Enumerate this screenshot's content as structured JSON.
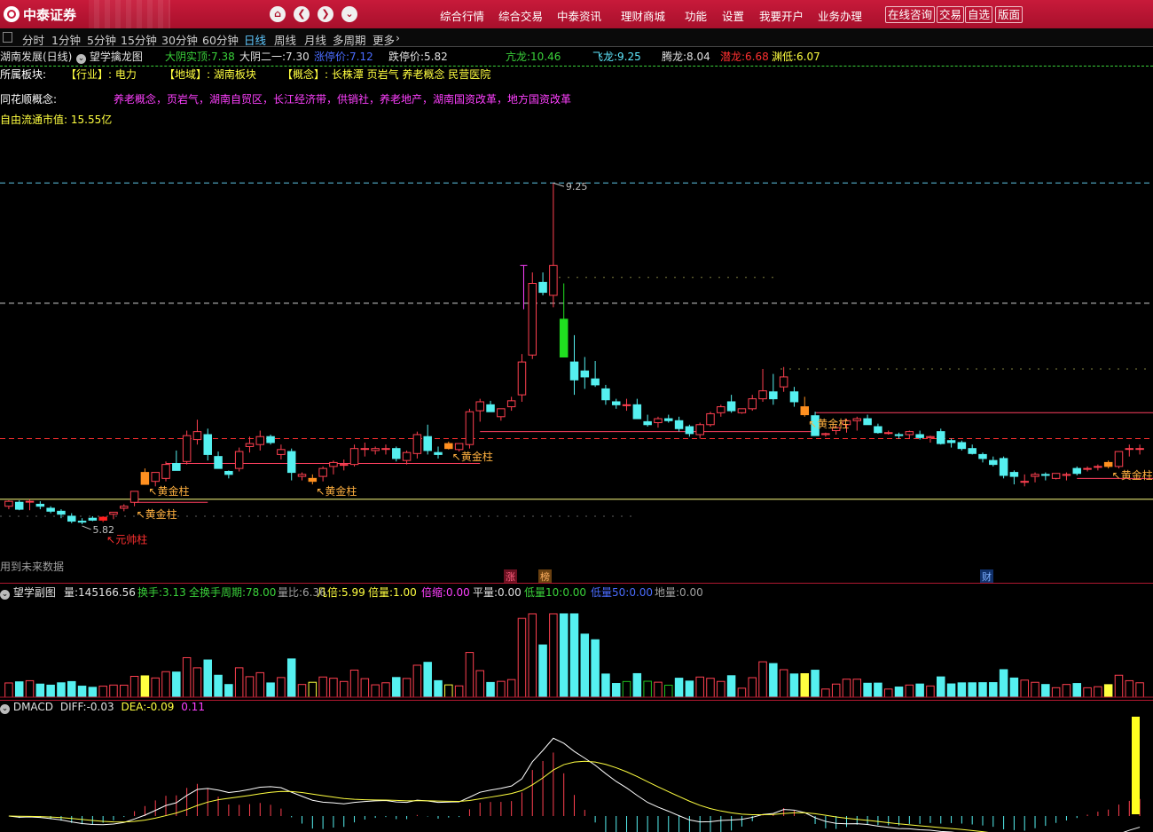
{
  "topbar": {
    "logo": "中泰证券",
    "menu": [
      "综合行情",
      "综合交易",
      "中泰资讯",
      "理财商城",
      "功能",
      "设置",
      "我要开户",
      "业务办理"
    ],
    "buttons": [
      "在线咨询",
      "交易",
      "自选",
      "版面"
    ]
  },
  "periods": {
    "items": [
      "分时",
      "1分钟",
      "5分钟",
      "15分钟",
      "30分钟",
      "60分钟",
      "日线",
      "周线",
      "月线",
      "多周期",
      "更多"
    ],
    "active": "日线"
  },
  "header": {
    "title": "湖南发展(日线)",
    "indicator_name": "望学擒龙图",
    "stats": [
      {
        "label": "大阴实顶:",
        "value": "7.38",
        "color": "#3ad23a"
      },
      {
        "label": "大阴二一:",
        "value": "7.30",
        "color": "#e0e0e0"
      },
      {
        "label": "涨停价:",
        "value": "7.12",
        "color": "#4a6cff"
      },
      {
        "label": "跌停价:",
        "value": "5.82",
        "color": "#e0e0e0"
      },
      {
        "label": "亢龙:",
        "value": "10.46",
        "color": "#3ad23a"
      },
      {
        "label": "飞龙:",
        "value": "9.25",
        "color": "#5fe8ff"
      },
      {
        "label": "腾龙:",
        "value": "8.04",
        "color": "#e0e0e0"
      },
      {
        "label": "潜龙:",
        "value": "6.68",
        "color": "#ff3030"
      },
      {
        "label": "渊低:",
        "value": "6.07",
        "color": "#ffff40"
      }
    ]
  },
  "info": {
    "sector_label": "所属板块:",
    "industry": "【行业】: 电力",
    "region": "【地域】: 湖南板块",
    "concept": "【概念】: 长株潭 页岩气 养老概念 民营医院",
    "ths_label": "同花顺概念:",
    "ths_concepts": "养老概念，页岩气，湖南自贸区，长江经济带，供销社，养老地产，湖南国资改革，地方国资改革",
    "float_cap": "自由流通市值: 15.55亿"
  },
  "main_chart": {
    "annotations": {
      "high_label": "9.25",
      "low_label": "5.82",
      "gold": "黄金柱",
      "yuanshuai": "元帅柱",
      "future": "用到未来数据",
      "zhang": "涨",
      "bang": "榜",
      "cai": "财"
    },
    "candles": [
      [
        6.0,
        6.06,
        5.97,
        6.05
      ],
      [
        6.04,
        6.06,
        5.96,
        5.97
      ],
      [
        6.05,
        6.07,
        5.96,
        6.05
      ],
      [
        6.02,
        6.05,
        5.97,
        6.0
      ],
      [
        5.98,
        6.0,
        5.93,
        5.95
      ],
      [
        5.95,
        5.97,
        5.88,
        5.92
      ],
      [
        5.9,
        5.93,
        5.83,
        5.85
      ],
      [
        5.85,
        5.88,
        5.82,
        5.84
      ],
      [
        5.88,
        5.9,
        5.85,
        5.86
      ],
      [
        5.86,
        5.9,
        5.84,
        5.89
      ],
      [
        5.92,
        5.94,
        5.87,
        5.94
      ],
      [
        5.98,
        6.02,
        5.95,
        6.0
      ],
      [
        6.04,
        6.15,
        6.0,
        6.15
      ],
      [
        6.34,
        6.38,
        6.22,
        6.22
      ],
      [
        6.25,
        6.34,
        6.2,
        6.34
      ],
      [
        6.28,
        6.45,
        6.25,
        6.42
      ],
      [
        6.43,
        6.56,
        6.36,
        6.36
      ],
      [
        6.45,
        6.76,
        6.42,
        6.71
      ],
      [
        6.67,
        6.87,
        6.62,
        6.75
      ],
      [
        6.72,
        6.78,
        6.46,
        6.52
      ],
      [
        6.5,
        6.55,
        6.38,
        6.38
      ],
      [
        6.35,
        6.36,
        6.28,
        6.32
      ],
      [
        6.38,
        6.59,
        6.35,
        6.55
      ],
      [
        6.6,
        6.7,
        6.54,
        6.63
      ],
      [
        6.62,
        6.76,
        6.56,
        6.7
      ],
      [
        6.7,
        6.72,
        6.62,
        6.64
      ],
      [
        6.52,
        6.62,
        6.47,
        6.57
      ],
      [
        6.55,
        6.58,
        6.26,
        6.34
      ],
      [
        6.3,
        6.34,
        6.26,
        6.32
      ],
      [
        6.25,
        6.32,
        6.22,
        6.28
      ],
      [
        6.3,
        6.4,
        6.25,
        6.38
      ],
      [
        6.4,
        6.46,
        6.32,
        6.44
      ],
      [
        6.42,
        6.47,
        6.36,
        6.42
      ],
      [
        6.42,
        6.62,
        6.4,
        6.58
      ],
      [
        6.58,
        6.64,
        6.5,
        6.58
      ],
      [
        6.56,
        6.6,
        6.52,
        6.58
      ],
      [
        6.58,
        6.62,
        6.52,
        6.58
      ],
      [
        6.58,
        6.6,
        6.45,
        6.48
      ],
      [
        6.46,
        6.56,
        6.42,
        6.54
      ],
      [
        6.53,
        6.75,
        6.48,
        6.72
      ],
      [
        6.7,
        6.82,
        6.52,
        6.56
      ],
      [
        6.54,
        6.6,
        6.48,
        6.52
      ],
      [
        6.58,
        6.65,
        6.57,
        6.63
      ],
      [
        6.57,
        6.62,
        6.55,
        6.63
      ],
      [
        6.62,
        6.98,
        6.58,
        6.95
      ],
      [
        6.96,
        7.08,
        6.85,
        7.05
      ],
      [
        7.02,
        7.06,
        6.95,
        6.95
      ],
      [
        6.9,
        6.98,
        6.86,
        6.98
      ],
      [
        7.0,
        7.1,
        6.96,
        7.06
      ],
      [
        7.12,
        7.53,
        7.05,
        7.45
      ],
      [
        7.52,
        8.35,
        7.48,
        8.24
      ],
      [
        8.25,
        8.35,
        8.12,
        8.15
      ],
      [
        8.12,
        9.25,
        8.0,
        8.42
      ],
      [
        7.88,
        8.24,
        7.51,
        7.5
      ],
      [
        7.45,
        7.72,
        7.12,
        7.27
      ],
      [
        7.36,
        7.5,
        7.18,
        7.3
      ],
      [
        7.28,
        7.46,
        7.2,
        7.22
      ],
      [
        7.18,
        7.22,
        7.02,
        7.07
      ],
      [
        7.05,
        7.08,
        6.98,
        7.02
      ],
      [
        7.02,
        7.08,
        6.96,
        7.02
      ],
      [
        7.02,
        7.08,
        6.88,
        6.88
      ],
      [
        6.85,
        6.92,
        6.8,
        6.82
      ],
      [
        6.84,
        6.9,
        6.79,
        6.88
      ],
      [
        6.88,
        6.92,
        6.84,
        6.86
      ],
      [
        6.86,
        6.9,
        6.75,
        6.78
      ],
      [
        6.8,
        6.82,
        6.7,
        6.73
      ],
      [
        6.72,
        6.84,
        6.68,
        6.82
      ],
      [
        6.82,
        6.95,
        6.8,
        6.93
      ],
      [
        6.94,
        7.02,
        6.9,
        7.0
      ],
      [
        7.05,
        7.12,
        6.94,
        6.96
      ],
      [
        6.94,
        6.98,
        6.93,
        6.98
      ],
      [
        6.98,
        7.12,
        6.96,
        7.08
      ],
      [
        7.08,
        7.38,
        7.05,
        7.16
      ],
      [
        7.15,
        7.33,
        7.02,
        7.08
      ],
      [
        7.2,
        7.4,
        7.15,
        7.3
      ],
      [
        7.15,
        7.2,
        7.0,
        7.05
      ],
      [
        7.0,
        7.1,
        6.9,
        6.92
      ],
      [
        6.91,
        6.95,
        6.72,
        6.71
      ],
      [
        6.72,
        6.74,
        6.7,
        6.73
      ],
      [
        6.76,
        6.81,
        6.72,
        6.79
      ],
      [
        6.82,
        6.88,
        6.74,
        6.86
      ],
      [
        6.86,
        6.9,
        6.76,
        6.88
      ],
      [
        6.88,
        6.92,
        6.82,
        6.82
      ],
      [
        6.8,
        6.83,
        6.73,
        6.74
      ],
      [
        6.74,
        6.76,
        6.72,
        6.74
      ],
      [
        6.72,
        6.74,
        6.68,
        6.71
      ],
      [
        6.72,
        6.76,
        6.68,
        6.75
      ],
      [
        6.72,
        6.76,
        6.67,
        6.69
      ],
      [
        6.69,
        6.71,
        6.64,
        6.7
      ],
      [
        6.75,
        6.78,
        6.62,
        6.63
      ],
      [
        6.66,
        6.68,
        6.59,
        6.64
      ],
      [
        6.64,
        6.66,
        6.56,
        6.58
      ],
      [
        6.58,
        6.62,
        6.52,
        6.53
      ],
      [
        6.52,
        6.54,
        6.44,
        6.48
      ],
      [
        6.46,
        6.5,
        6.4,
        6.42
      ],
      [
        6.48,
        6.5,
        6.28,
        6.31
      ],
      [
        6.34,
        6.36,
        6.22,
        6.3
      ],
      [
        6.25,
        6.32,
        6.2,
        6.25
      ],
      [
        6.3,
        6.34,
        6.24,
        6.32
      ],
      [
        6.32,
        6.34,
        6.26,
        6.31
      ],
      [
        6.28,
        6.32,
        6.27,
        6.33
      ],
      [
        6.31,
        6.34,
        6.26,
        6.32
      ],
      [
        6.38,
        6.4,
        6.31,
        6.33
      ],
      [
        6.38,
        6.4,
        6.35,
        6.38
      ],
      [
        6.4,
        6.42,
        6.36,
        6.4
      ],
      [
        6.44,
        6.46,
        6.38,
        6.4
      ],
      [
        6.4,
        6.55,
        6.38,
        6.55
      ],
      [
        6.58,
        6.62,
        6.5,
        6.58
      ],
      [
        6.58,
        6.62,
        6.52,
        6.58
      ]
    ],
    "gold_bars": [
      13,
      29,
      42,
      76,
      105
    ],
    "yuanshuai_bar": 9
  },
  "vol_panel": {
    "title": "望学副图",
    "stats": [
      {
        "label": "量:",
        "value": "145166.56",
        "color": "#e0e0e0"
      },
      {
        "label": "换手:",
        "value": "3.13",
        "color": "#3ad23a"
      },
      {
        "label": "全换手周期:",
        "value": "78.00",
        "color": "#3ad23a"
      },
      {
        "label": "量比:",
        "value": "6.36",
        "color": "#a0a0a0"
      },
      {
        "label": "几倍:",
        "value": "5.99",
        "color": "#ffff40"
      },
      {
        "label": "倍量:",
        "value": "1.00",
        "color": "#ffff40"
      },
      {
        "label": "倍缩:",
        "value": "0.00",
        "color": "#ff40ff"
      },
      {
        "label": "平量:",
        "value": "0.00",
        "color": "#e0e0e0"
      },
      {
        "label": "低量10:",
        "value": "0.00",
        "color": "#3ad23a"
      },
      {
        "label": "低量50:",
        "value": "0.00",
        "color": "#4a6cff"
      },
      {
        "label": "地量:",
        "value": "0.00",
        "color": "#a0a0a0"
      }
    ]
  },
  "macd_panel": {
    "title": "DMACD",
    "diff_label": "DIFF:",
    "diff": "-0.03",
    "dea_label": "DEA:",
    "dea": "-0.09",
    "macd": "0.11"
  }
}
